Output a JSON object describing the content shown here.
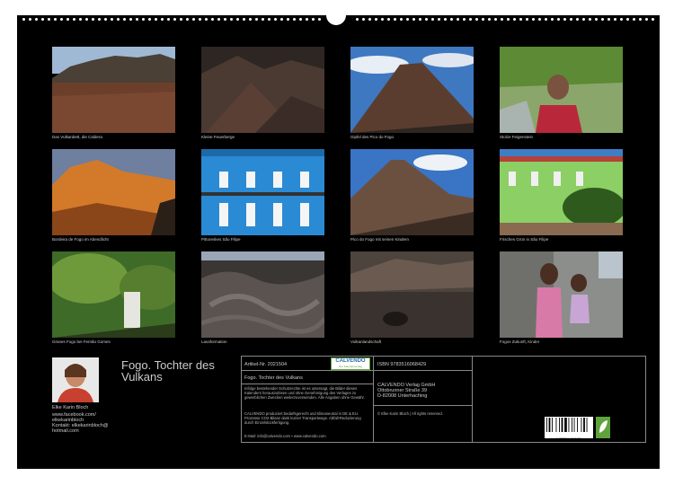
{
  "captions": [
    "Das Vulkanbett, die Caldera",
    "Kleine Feuerberge",
    "Gipfel des Pico do Fogo",
    "Stolze Feigenstein",
    "Bordeira de Fogo im Abendlicht",
    "Pittoreskes São Filipe",
    "Pico do Fogo mit seinen Kindern",
    "Frisches Grün in São Filipe",
    "Grünes Fogo bei Fernão Gomes",
    "Lavaformation",
    "Vulkanlandschaft",
    "Fogos Zukunft, Kinder"
  ],
  "author": {
    "title": "Fogo. Tochter des Vulkans",
    "name": "Elke Karin Bloch",
    "contact": [
      "www.facebook.com/",
      "elkekarinbloch",
      "Kontakt: elkekarinbloch@",
      "hotmail.com"
    ]
  },
  "imprint": {
    "artikel": "Artikel-Nr. 2021504",
    "brand": "CALVENDO",
    "brand_sub": "Der Kalenderverlag",
    "title": "Fogo. Tochter des Vulkans",
    "text1": "Infolge bestehender Schutzrechte ist es untersagt, die Bilder dieses Kalenders herauszulösen und ohne Genehmigung des Verlages zu gewerblichen Zwecken weiterzuverwenden. Alle Angaben ohne Gewähr.",
    "text2": "CALVENDO produziert bedarfsgerecht und klimaneutral in DE & EU. Prozesse CO2-Bilanz dank kurzer Transportwege. Abfall-Reduzierung durch Einzelstückfertigung.",
    "email": "E-Mail: info@calvendo.com • www.calvendo.com",
    "isbn": "ISBN 9783516068429",
    "publisher": [
      "CALVENDO Verlag GmbH",
      "Ottobrunner Straße 39",
      "D-82008 Unterhaching"
    ],
    "copyright": "© Elke Karin Bloch | All rights reserved.",
    "barcode_digits": "9 783516 068429"
  },
  "colors": {
    "background": "#000000",
    "brand_green": "#5fa33a"
  }
}
